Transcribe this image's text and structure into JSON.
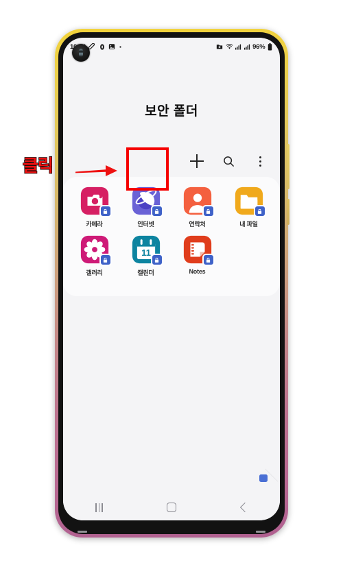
{
  "status_bar": {
    "time": "10:44",
    "left_icons": [
      "pill-icon",
      "dot-zero-icon",
      "image-icon",
      "dot-icon"
    ],
    "right_icons": [
      "folder-badge-icon",
      "wifi-icon",
      "signal-bars-icon",
      "signal-bars-2-icon"
    ],
    "battery_percent": "96%"
  },
  "app": {
    "title": "보안 폴더"
  },
  "toolbar": {
    "add_label": "+",
    "add_name": "add-apps-button",
    "search_name": "search-button",
    "overflow_name": "more-options-button"
  },
  "annotation": {
    "click_label": "클릭",
    "arrow_name": "red-arrow",
    "highlight_name": "red-highlight-box",
    "color": "#f50000",
    "text_color": "#ee1111",
    "outline_color": "#0a0a0a"
  },
  "app_grid": {
    "rows": [
      [
        {
          "label": "카메라",
          "icon": "camera-icon",
          "color": "#d61f63",
          "secure": true
        },
        {
          "label": "인터넷",
          "icon": "internet-icon",
          "color": "#6a62d6",
          "secure": true
        },
        {
          "label": "연락처",
          "icon": "contacts-icon",
          "color": "#f4603f",
          "secure": true
        },
        {
          "label": "내 파일",
          "icon": "my-files-icon",
          "color": "#f0a91c",
          "secure": true
        }
      ],
      [
        {
          "label": "갤러리",
          "icon": "gallery-icon",
          "color": "#ce1a77",
          "secure": true
        },
        {
          "label": "캘린더",
          "icon": "calendar-icon",
          "color": "#0d84a0",
          "secure": true,
          "day": "11"
        },
        {
          "label": "Notes",
          "icon": "notes-icon",
          "color": "#e03d1c",
          "secure": true
        }
      ]
    ],
    "badge_color": "#3f62c8"
  },
  "navigation_bar": {
    "recents_label": "recents-button",
    "home_label": "home-button",
    "back_label": "back-button"
  },
  "device": {
    "frame_top_color": "#f2d23a",
    "frame_bottom_color": "#b06090",
    "bezel_color": "#121212",
    "screen_bg": "#f4f4f6"
  }
}
